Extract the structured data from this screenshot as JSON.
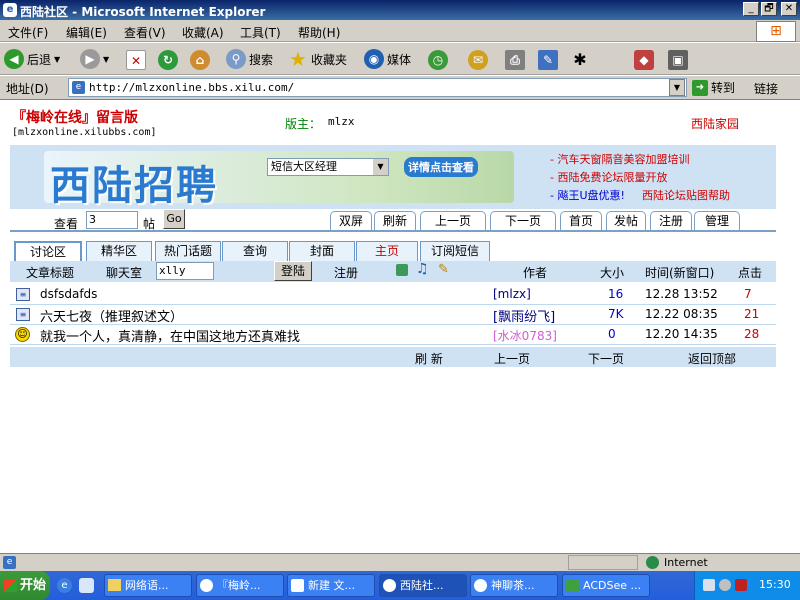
{
  "window": {
    "title": "西陆社区 - Microsoft Internet Explorer",
    "controls": [
      "_",
      "🗗",
      "✕"
    ]
  },
  "menu": [
    "文件(F)",
    "编辑(E)",
    "查看(V)",
    "收藏(A)",
    "工具(T)",
    "帮助(H)"
  ],
  "toolbar": {
    "back": "后退",
    "search": "搜索",
    "favorites": "收藏夹",
    "media": "媒体"
  },
  "address": {
    "label": "地址(D)",
    "url": "http://mlzxonline.bbs.xilu.com/",
    "go": "转到",
    "links": "链接"
  },
  "page": {
    "site_title": "『梅岭在线』留言版",
    "site_url": "[mlzxonline.xilubbs.com]",
    "moderator_label": "版主：",
    "moderator": "mlzx",
    "home_link": "西陆家园",
    "banner": {
      "brand": "西陆招聘",
      "select_value": "短信大区经理",
      "detail_button": "详情点击查看"
    },
    "ads": [
      "- 汽车天窗隔音美容加盟培训",
      "- 西陆免费论坛限量开放",
      "- 飚王U盘优惠!",
      "西陆论坛贴图帮助"
    ],
    "view": {
      "label": "查看",
      "value": "3",
      "unit": "帖",
      "go": "Go"
    },
    "nav_tabs": [
      "双屏",
      "刷新",
      "上一页",
      "下一页",
      "首页",
      "发帖",
      "注册",
      "管理"
    ],
    "forum_tabs": [
      "讨论区",
      "精华区",
      "热门话题",
      "查询",
      "封面",
      "主页",
      "订阅短信"
    ],
    "header": {
      "subject": "文章标题",
      "chatroom_label": "聊天室",
      "chatroom_value": "xlly",
      "login": "登陆",
      "register": "注册",
      "author": "作者",
      "size": "大小",
      "time": "时间(新窗口)",
      "clicks": "点击"
    },
    "posts": [
      {
        "title": "dsfsdafds",
        "author": "[mlzx]",
        "size": "16",
        "time": "12.28 13:52",
        "clicks": "7"
      },
      {
        "title": "六天七夜（推理叙述文）",
        "author": "[飘雨纷飞]",
        "size": "7K",
        "time": "12.22 08:35",
        "clicks": "21"
      },
      {
        "title": "就我一个人，真清静，在中国这地方还真难找",
        "author": "[水冰0783]",
        "size": "0",
        "time": "12.20 14:35",
        "clicks": "28"
      }
    ],
    "footer": {
      "refresh": "刷 新",
      "prev": "上一页",
      "next": "下一页",
      "top": "返回顶部"
    }
  },
  "status": {
    "zone": "Internet"
  },
  "taskbar": {
    "start": "开始",
    "items": [
      "网络语...",
      "『梅岭...",
      "新建 文...",
      "西陆社...",
      "神聊茶...",
      "ACDSee ..."
    ],
    "time": "15:30"
  },
  "colors": {
    "title_red": "#cc0000",
    "accent_blue": "#0a246a",
    "banner_bg": "#cfe2f4"
  }
}
